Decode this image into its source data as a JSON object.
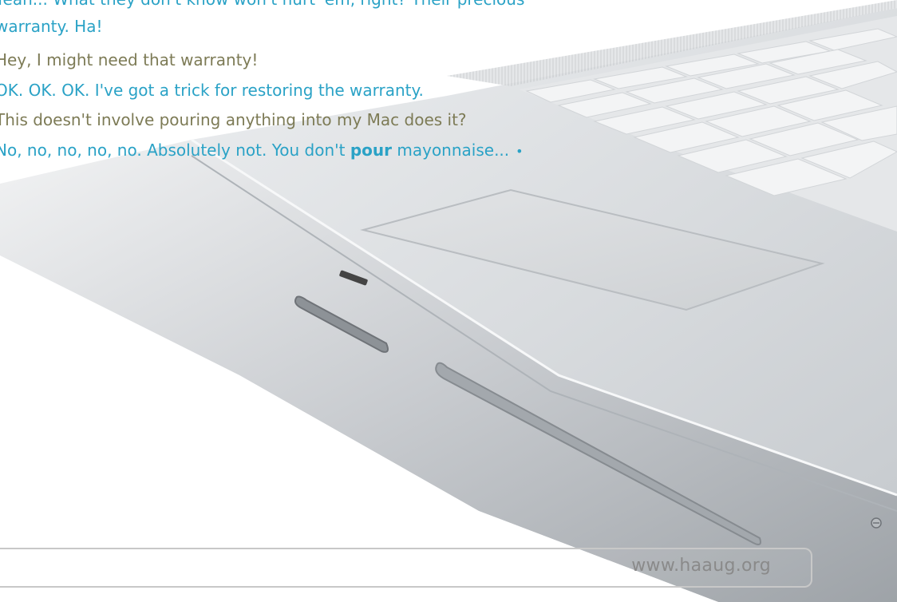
{
  "dialogue": [
    {
      "text": "Yeah... What they don't know won't hurt 'em, right?  Their precious",
      "speaker": "blue"
    },
    {
      "text": "warranty.  Ha!",
      "speaker": "blue"
    },
    {
      "text": "Hey, I might need that warranty!",
      "speaker": "olive"
    },
    {
      "text": "OK.  OK.  OK.  I've got a trick for restoring the warranty.",
      "speaker": "blue"
    },
    {
      "text": "This doesn't involve pouring anything into my Mac does it?",
      "speaker": "olive"
    },
    {
      "text_before": "No, no, no, no, no.  Absolutely not.  You don't ",
      "text_bold": "pour",
      "text_after": " mayonnaise...",
      "bullet": "•",
      "speaker": "blue"
    }
  ],
  "footer": {
    "url": "www.haaug.org"
  },
  "colors": {
    "blue_speaker": "#2aa2c6",
    "olive_speaker": "#7d7b56",
    "footer_text": "#8a8a8a"
  }
}
